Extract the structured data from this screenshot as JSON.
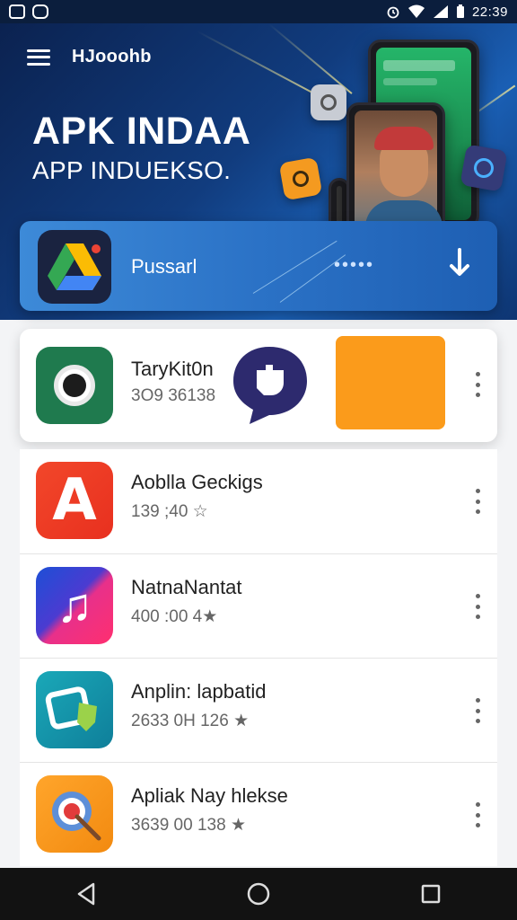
{
  "status_bar": {
    "time": "22:39"
  },
  "header": {
    "brand": "HJooohb"
  },
  "hero": {
    "title": "APK INDAA",
    "subtitle": "APP INDUEKSO."
  },
  "downloader": {
    "label": "Pussarl",
    "dots": "•••••"
  },
  "featured": {
    "name": "TaryKit0n",
    "meta": "3O9 36138"
  },
  "apps": [
    {
      "name": "Aoblla Geckigs",
      "meta": "139 ;40 ☆",
      "icon": "red-a-app-icon"
    },
    {
      "name": "NatnaNantat",
      "meta": "400 :00 4★",
      "icon": "music-note-app-icon"
    },
    {
      "name": "Anplin: lapbatid",
      "meta": "2633 0H 126 ★",
      "icon": "teal-shield-app-icon"
    },
    {
      "name": "Apliak Nay hlekse",
      "meta": "3639 00 138 ★",
      "icon": "target-app-icon"
    }
  ],
  "colors": {
    "hero_bg": "#113c7e",
    "downloader_bg": "#2b72c6",
    "accent_orange": "#fb9b1b"
  }
}
